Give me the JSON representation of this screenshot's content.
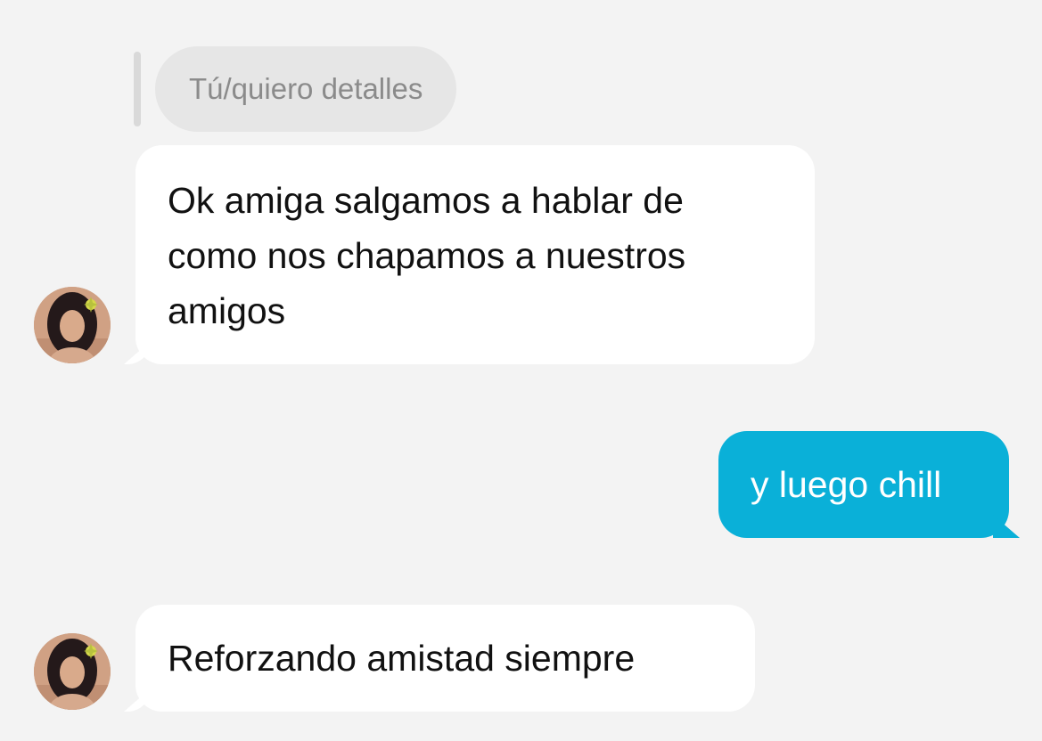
{
  "reply": {
    "text": "Tú/quiero detalles"
  },
  "messages": [
    {
      "direction": "incoming",
      "text": "Ok amiga salgamos a hablar de como nos chapamos a nuestros amigos"
    },
    {
      "direction": "outgoing",
      "text": "y luego chill"
    },
    {
      "direction": "incoming",
      "text": "Reforzando amistad siempre"
    }
  ],
  "colors": {
    "background": "#f3f3f3",
    "incoming_bubble": "#ffffff",
    "outgoing_bubble": "#0ab0d8",
    "reply_bubble": "#e6e6e6",
    "reply_text": "#8b8b8b"
  },
  "icons": {
    "avatar": "contact-profile-photo"
  }
}
